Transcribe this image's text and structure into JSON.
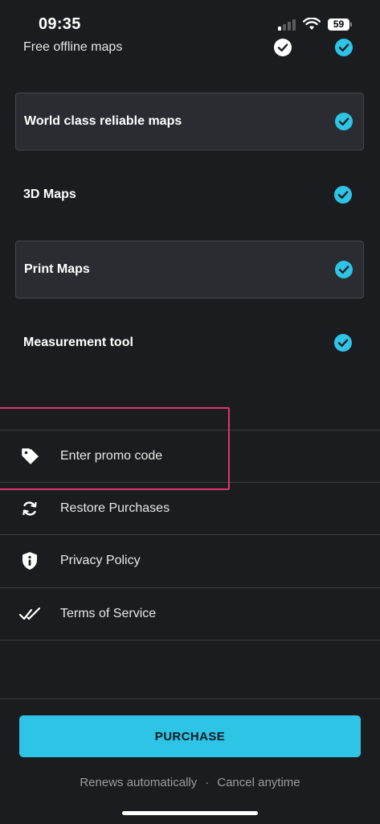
{
  "status_bar": {
    "time": "09:35",
    "battery": "59"
  },
  "comparison": {
    "free_row": {
      "label": "Free offline maps",
      "free_included": true,
      "premium_included": true
    },
    "features": [
      {
        "label": "World class reliable maps",
        "boxed": true
      },
      {
        "label": "3D Maps",
        "boxed": false
      },
      {
        "label": "Print Maps",
        "boxed": true
      },
      {
        "label": "Measurement tool",
        "boxed": false
      }
    ]
  },
  "menu": {
    "items": [
      {
        "label": "Enter promo code",
        "icon": "tag-icon"
      },
      {
        "label": "Restore Purchases",
        "icon": "refresh-icon"
      },
      {
        "label": "Privacy Policy",
        "icon": "shield-info-icon"
      },
      {
        "label": "Terms of Service",
        "icon": "double-check-icon"
      }
    ]
  },
  "purchase": {
    "button_label": "PURCHASE",
    "renews_text": "Renews automatically",
    "separator": "·",
    "cancel_text": "Cancel anytime"
  },
  "colors": {
    "background": "#1b1c20",
    "accent": "#2ec4e6",
    "boxed_row": "#2b2c31",
    "highlight": "#e0336f"
  }
}
